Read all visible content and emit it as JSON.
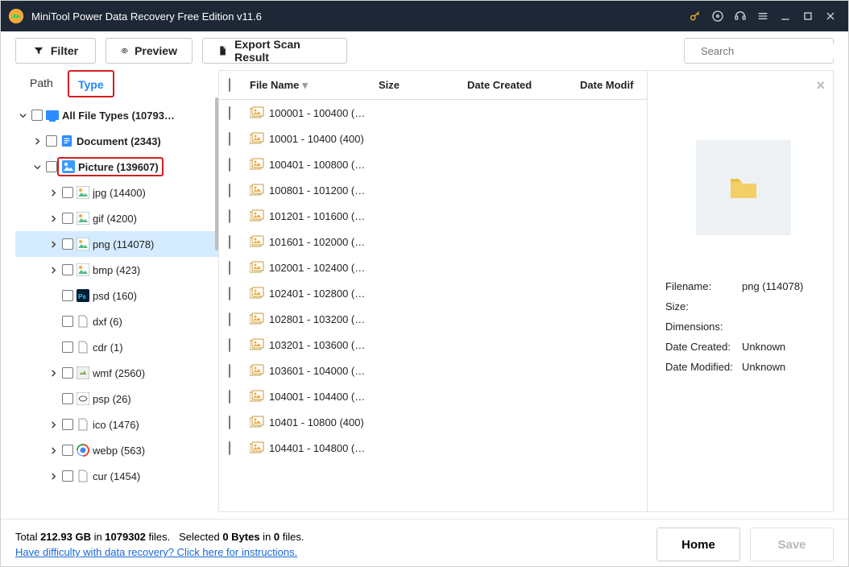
{
  "title": "MiniTool Power Data Recovery Free Edition v11.6",
  "toolbar": {
    "filter": "Filter",
    "preview": "Preview",
    "export": "Export Scan Result"
  },
  "search": {
    "placeholder": "Search"
  },
  "side_tabs": {
    "path": "Path",
    "type": "Type"
  },
  "tree": {
    "root": "All File Types (10793…",
    "document": "Document (2343)",
    "picture": "Picture (139607)",
    "children": [
      {
        "label": "jpg (14400)",
        "expand": true,
        "icon": "img"
      },
      {
        "label": "gif (4200)",
        "expand": true,
        "icon": "img"
      },
      {
        "label": "png (114078)",
        "expand": true,
        "icon": "img",
        "selected": true
      },
      {
        "label": "bmp (423)",
        "expand": true,
        "icon": "img"
      },
      {
        "label": "psd (160)",
        "expand": false,
        "icon": "psd"
      },
      {
        "label": "dxf (6)",
        "expand": false,
        "icon": "file"
      },
      {
        "label": "cdr (1)",
        "expand": false,
        "icon": "file"
      },
      {
        "label": "wmf (2560)",
        "expand": true,
        "icon": "wmf"
      },
      {
        "label": "psp (26)",
        "expand": false,
        "icon": "psp"
      },
      {
        "label": "ico (1476)",
        "expand": true,
        "icon": "file"
      },
      {
        "label": "webp (563)",
        "expand": true,
        "icon": "webp"
      },
      {
        "label": "cur (1454)",
        "expand": true,
        "icon": "file"
      }
    ]
  },
  "columns": {
    "name": "File Name",
    "size": "Size",
    "dc": "Date Created",
    "dm": "Date Modif"
  },
  "rows": [
    {
      "name": "100001 - 100400 (…"
    },
    {
      "name": "10001 - 10400 (400)"
    },
    {
      "name": "100401 - 100800 (…"
    },
    {
      "name": "100801 - 101200 (…"
    },
    {
      "name": "101201 - 101600 (…"
    },
    {
      "name": "101601 - 102000 (…"
    },
    {
      "name": "102001 - 102400 (…"
    },
    {
      "name": "102401 - 102800 (…"
    },
    {
      "name": "102801 - 103200 (…"
    },
    {
      "name": "103201 - 103600 (…"
    },
    {
      "name": "103601 - 104000 (…"
    },
    {
      "name": "104001 - 104400 (…"
    },
    {
      "name": "10401 - 10800 (400)"
    },
    {
      "name": "104401 - 104800 (…"
    }
  ],
  "preview": {
    "filename_k": "Filename:",
    "filename_v": "png (114078)",
    "size_k": "Size:",
    "size_v": "",
    "dim_k": "Dimensions:",
    "dim_v": "",
    "dc_k": "Date Created:",
    "dc_v": "Unknown",
    "dm_k": "Date Modified:",
    "dm_v": "Unknown"
  },
  "footer": {
    "total_pre": "Total ",
    "total_size": "212.93 GB",
    "total_mid": " in ",
    "total_files": "1079302",
    "total_post": " files.",
    "sel_pre": "Selected ",
    "sel_bytes": "0 Bytes",
    "sel_mid": " in ",
    "sel_n": "0",
    "sel_post": " files.",
    "help": "Have difficulty with data recovery? Click here for instructions.",
    "home": "Home",
    "save": "Save"
  }
}
